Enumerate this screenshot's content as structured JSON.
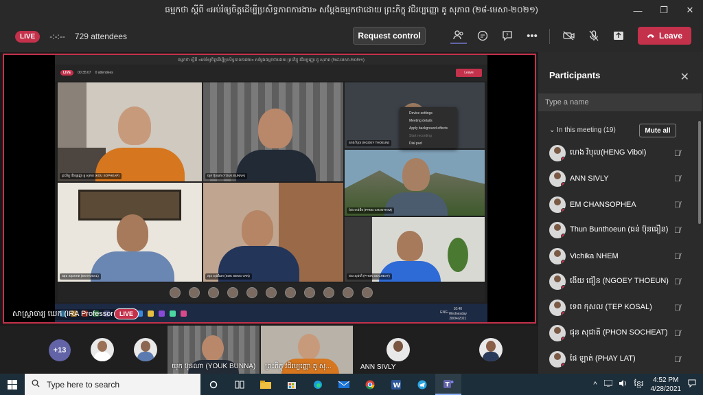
{
  "window": {
    "title": "ធម្មកថា ស្តីពី «អប់រំឲ្យចិត្តដើម្បីប្រសិទ្ធភាពការងារ» សម្តែងធម្មកថាដោយ ព្រះភិក្ខុ វជិរប្បញ្ញោ គូ សុភាព (២៨-មេសា-២០២១)",
    "controls": [
      "—",
      "❐",
      "✕"
    ]
  },
  "toolbar": {
    "live": "LIVE",
    "timer": "-:-:--",
    "attendees": "729 attendees",
    "request_control": "Request control",
    "leave": "Leave"
  },
  "shared_screen": {
    "inner_title": "ធម្មកថា ស្តីពី «អប់រំឲ្យចិត្តដើម្បីប្រសិទ្ធភាពការងារ» សម្តែងធម្មកថាដោយ ព្រះភិក្ខុ វជិរប្បញ្ញោ គូ សុភាព (២៨-មេសា-២០២១)",
    "inner_live": "LIVE",
    "inner_timer": "00:35:07",
    "inner_attendees": "0 attendees",
    "inner_leave": "Leave",
    "tiles": [
      {
        "name": "ព្រះភិក្ខុ វជិរប្បញ្ញោ គូ សុភាព (KOU SOPHEAP)"
      },
      {
        "name": "យុក ប៊ុនណា (YOUK BUNNA)"
      },
      {
        "name": "ហេង វិបុល (NGOEY THOEUN)"
      },
      {
        "name": "ប៉ាង ចាន់ធីម (PANG CHANTHIM)"
      },
      {
        "name": "ឈុន ឈុនហាត (EM KOSAL)"
      },
      {
        "name": "សុខ សុងវីណា (SOK SENG VAN)"
      },
      {
        "name": "ផល សុជាតិ (PHON SOCHEAT)"
      }
    ],
    "menu": [
      "Device settings",
      "Meeting details",
      "Apply background effects",
      "Start recording",
      "Dial pad"
    ],
    "inner_clock_time": "10:40",
    "inner_clock_day": "Wednesday",
    "inner_clock_date": "28/04/2021",
    "inner_lang": "ENG",
    "presenter_label": "សាស្ត្រាចារ្យ ឃេក (IRA Professor 02)",
    "presenter_live": "LIVE"
  },
  "gallery": {
    "more": "+13",
    "videos": [
      {
        "name": "យុក ប៊ុនណា (YOUK BUNNA)"
      },
      {
        "name": "ព្រះភិក្ខុ វជិរប្បញ្ញោ គូ សុ..."
      }
    ],
    "label": "ANN SIVLY"
  },
  "participants": {
    "title": "Participants",
    "search_placeholder": "Type a name",
    "section": "In this meeting (19)",
    "mute_all": "Mute all",
    "list": [
      {
        "name": "ហេង វិបុល(HENG Vibol)"
      },
      {
        "name": "ANN SIVLY"
      },
      {
        "name": "EM CHANSOPHEA"
      },
      {
        "name": "Thun Bunthoeun (ធន់ ប៊ុនធឿន)"
      },
      {
        "name": "Vichika NHEM"
      },
      {
        "name": "ងើយ ធឿន (NGOEY THOEUN)"
      },
      {
        "name": "ទេព កុសល (TEP KOSAL)"
      },
      {
        "name": "ផុន សុជាតិ (PHON SOCHEAT)"
      },
      {
        "name": "ផៃ ឡាត់ (PHAY LAT)"
      }
    ]
  },
  "taskbar": {
    "search": "Type here to search",
    "time": "4:52 PM",
    "date": "4/28/2021",
    "lang": "ខ្មែរ"
  },
  "colors": {
    "accent": "#c4314b",
    "teams": "#6264a7"
  }
}
